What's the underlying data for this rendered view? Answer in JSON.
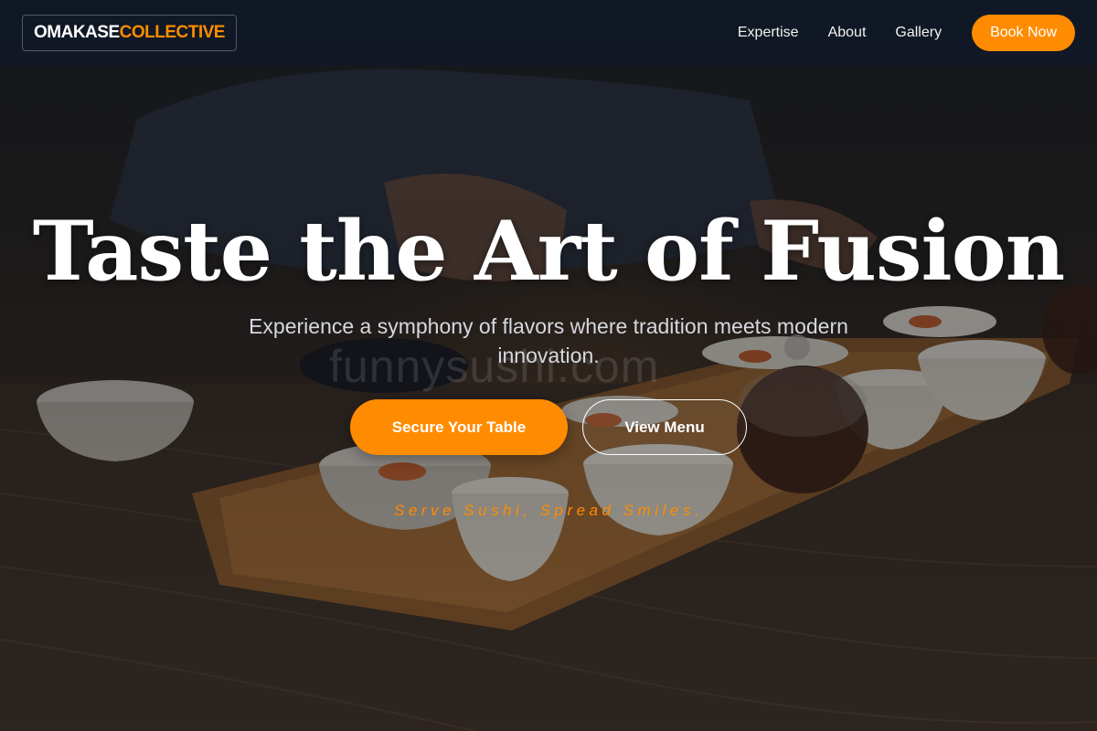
{
  "colors": {
    "accent": "#ff8c00",
    "nav_background": "#111827",
    "headline_text": "#ffffff",
    "subheading_text": "#d6d8e0"
  },
  "nav": {
    "logo_primary": "OMAKASE",
    "logo_secondary": "COLLECTIVE",
    "links": [
      {
        "label": "Expertise"
      },
      {
        "label": "About"
      },
      {
        "label": "Gallery"
      }
    ],
    "cta_label": "Book Now"
  },
  "hero": {
    "background_image": "chef-plating-sushi-flight-on-wooden-board",
    "headline": "Taste the Art of Fusion",
    "subheading": "Experience a symphony of flavors where tradition meets modern innovation.",
    "watermark": "funnysushi.com",
    "primary_button": "Secure Your Table",
    "secondary_button": "View Menu",
    "tagline": "Serve Sushi, Spread Smiles."
  }
}
